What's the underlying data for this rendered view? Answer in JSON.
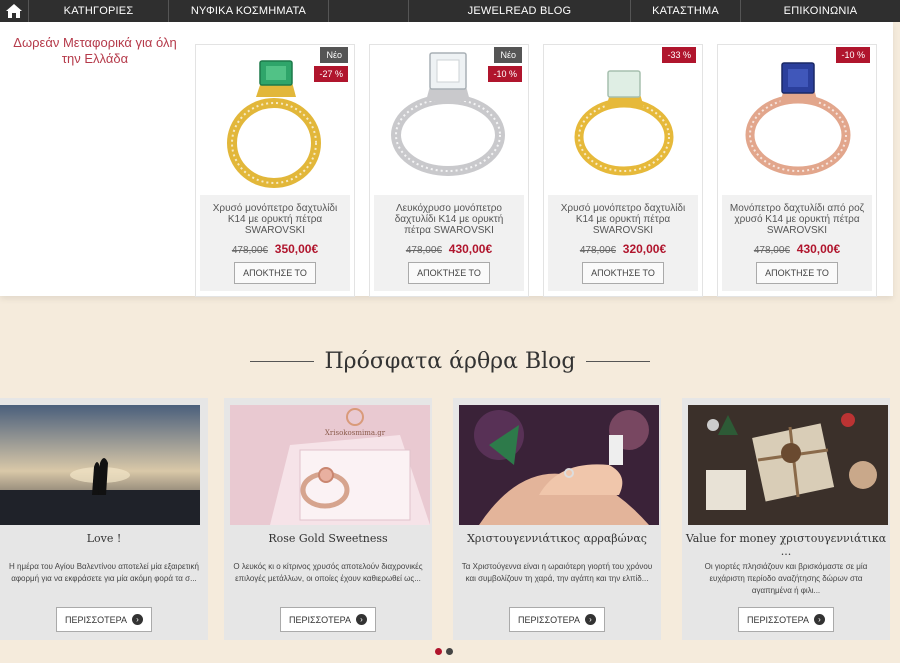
{
  "nav": {
    "items": [
      "ΚΑΤΗΓΟΡΙΕΣ",
      "ΝΥΦΙΚΑ ΚΟΣΜΗΜΑΤΑ",
      "JEWELREAD BLOG",
      "ΚΑΤΑΣΤΗΜΑ",
      "ΕΠΙΚΟΙΝΩΝΙΑ"
    ]
  },
  "shipping_text": "Δωρεάν Μεταφορικά για όλη την Ελλάδα",
  "products": [
    {
      "name": "Χρυσό μονόπετρο δαχτυλίδι Κ14 με ορυκτή πέτρα SWAROVSKI",
      "new_badge": "Νέο",
      "discount": "-27 %",
      "old_price": "478,00€",
      "price": "350,00€",
      "buy": "ΑΠΟΚΤΗΣΕ ΤΟ",
      "metal": "#e2b73a",
      "stone": "#2fa56a"
    },
    {
      "name": "Λευκόχρυσο μονόπετρο δαχτυλίδι Κ14 με ορυκτή πέτρα SWAROVSKI",
      "new_badge": "Νέο",
      "discount": "-10 %",
      "old_price": "478,00€",
      "price": "430,00€",
      "buy": "ΑΠΟΚΤΗΣΕ ΤΟ",
      "metal": "#c9c9cc",
      "stone": "#eef2f4"
    },
    {
      "name": "Χρυσό μονόπετρο δαχτυλίδι Κ14 με ορυκτή πέτρα SWAROVSKI",
      "new_badge": "",
      "discount": "-33 %",
      "old_price": "478,00€",
      "price": "320,00€",
      "buy": "ΑΠΟΚΤΗΣΕ ΤΟ",
      "metal": "#e6b93a",
      "stone": "#dfeee4"
    },
    {
      "name": "Μονόπετρο δαχτυλίδι από ροζ χρυσό Κ14 με ορυκτή πέτρα SWAROVSKI",
      "new_badge": "",
      "discount": "-10 %",
      "old_price": "478,00€",
      "price": "430,00€",
      "buy": "ΑΠΟΚΤΗΣΕ ΤΟ",
      "metal": "#e2a68c",
      "stone": "#2b3f9c"
    }
  ],
  "blog": {
    "title": "Πρόσφατα άρθρα Blog",
    "more_label": "ΠΕΡΙΣΣΟΤΕΡΑ",
    "posts": [
      {
        "title": "Love !",
        "desc": "Η ημέρα του Αγίου Βαλεντίνου αποτελεί μία εξαιρετική αφορμή για να εκφράσετε για μία ακόμη φορά τα σ..."
      },
      {
        "title": "Rose Gold Sweetness",
        "desc": "Ο λευκός κι ο κίτρινος χρυσός αποτελούν διαχρονικές επιλογές μετάλλων, οι οποίες έχουν καθιερωθεί ως..."
      },
      {
        "title": "Χριστουγεννιάτικος αρραβώνας",
        "desc": "Τα Χριστούγεννα είναι η ωραιότερη γιορτή του χρόνου και συμβολίζουν τη χαρά, την αγάπη και την ελπίδ..."
      },
      {
        "title": "Value for money χριστουγεννιάτικα ...",
        "desc": "Οι γιορτές πλησιάζουν και βρισκόμαστε σε μία ευχάριστη περίοδο αναζήτησης δώρων στα αγαπημένα ή φιλι..."
      }
    ],
    "photo_text": "Xrisokosmima.gr"
  },
  "carousel": {
    "active_color": "#b0152d",
    "inactive_color": "#444444"
  }
}
